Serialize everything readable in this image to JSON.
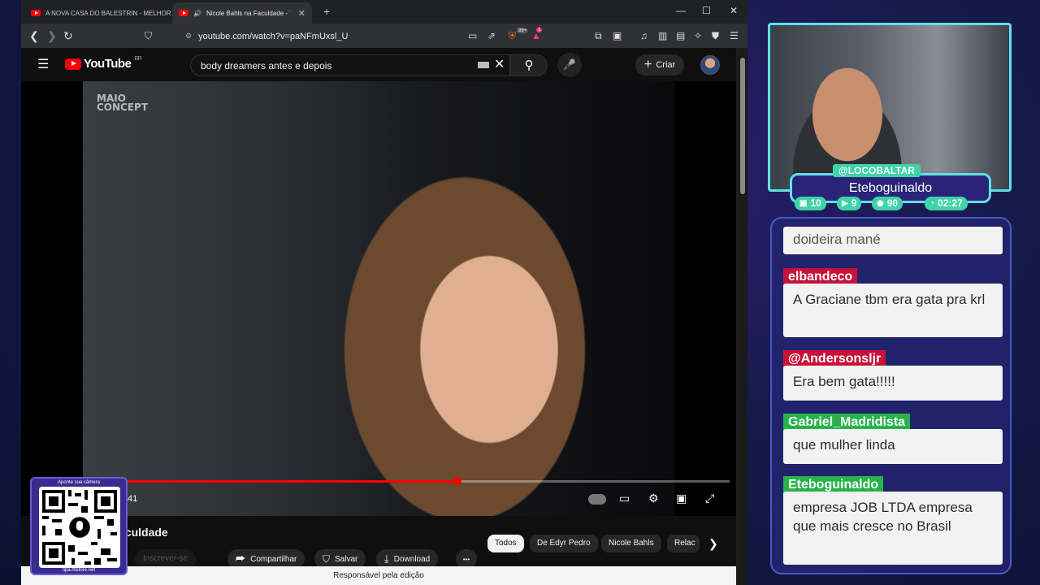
{
  "browser": {
    "tabs": [
      {
        "title": "A NOVA CASA DO BALESTRIN - MELHOR DO",
        "active": false
      },
      {
        "title": "Nicole Bahls na Faculdade - YouTube",
        "active": true
      }
    ],
    "new_tab": "+",
    "url": "youtube.com/watch?v=paNFmUxsl_U",
    "brave_badge": "99+",
    "rewards_badge": "1"
  },
  "youtube": {
    "logo_text": "YouTube",
    "region": "BR",
    "search_value": "body dreamers antes e depois",
    "create_label": "Criar",
    "video": {
      "watermark": "MAIO CONCEPT",
      "time": ":41",
      "progress_fraction": 0.61
    },
    "title": "aculdade",
    "subscribe_label": "Inscrever-se",
    "share_label": "Compartilhar",
    "save_label": "Salvar",
    "download_label": "Download",
    "more_label": "•••",
    "chips": [
      {
        "label": "Todos",
        "active": true
      },
      {
        "label": "De Edyr Pedro",
        "active": false
      },
      {
        "label": "Nicole Bahls",
        "active": false
      },
      {
        "label": "Relac",
        "active": false
      }
    ],
    "footer": "Responsável pela edição"
  },
  "overlay": {
    "qr_top": "Aponte sua câmera",
    "qr_bottom": "tipa.rbstore.net",
    "cam_tag": "@LOCOBALTAR",
    "cam_name": "Eteboguinaldo",
    "stats": [
      {
        "icon": "twitch-icon",
        "value": "10",
        "color": "#3ed3a8"
      },
      {
        "icon": "youtube-icon",
        "value": "9",
        "color": "#3ed3a8"
      },
      {
        "icon": "kick-icon",
        "value": "90",
        "color": "#3ed3a8"
      },
      {
        "icon": "clock-icon",
        "value": "02:27",
        "color": "#3ed3a8"
      }
    ]
  },
  "chat": {
    "partial_message": "doideira mané",
    "messages": [
      {
        "user": "elbandeco",
        "color": "#c8123a",
        "text": "A Graciane tbm era gata pra krl"
      },
      {
        "user": "@Andersonsljr",
        "color": "#c8123a",
        "text": "Era bem gata!!!!!"
      },
      {
        "user": "Gabriel_Madridista",
        "color": "#27b34a",
        "text": "que mulher linda"
      },
      {
        "user": "Eteboguinaldo",
        "color": "#27b34a",
        "text": "empresa JOB LTDA empresa que mais cresce no Brasil"
      }
    ]
  }
}
